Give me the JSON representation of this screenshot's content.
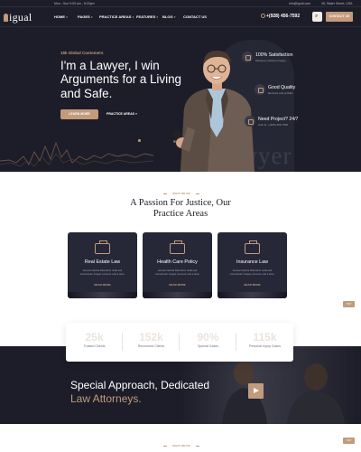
{
  "topbar": {
    "hours": "Mon - Sun 9:00 am - 8:00pm",
    "email": "info@igual.com",
    "address": "45, Water Street, USA"
  },
  "header": {
    "logo": "igual",
    "nav": [
      "HOME",
      "PAGES",
      "PRACTICE AREAS",
      "FEATURES",
      "BLOG",
      "CONTACT US"
    ],
    "phone": "+(928) 456-7592",
    "cta": "CONTACT US"
  },
  "hero": {
    "eyebrow": "15k Global Customers",
    "title": "I'm a Lawyer, I win Arguments for a Living and Safe.",
    "primary_button": "LEARN MORE",
    "secondary_link": "PRACTICE AREAS »",
    "watermark": "Lawyer",
    "features": [
      {
        "title": "100% Satisfaction",
        "subtitle": "Measure customer happy",
        "icon": "shield-icon"
      },
      {
        "title": "Good Quality",
        "subtitle": "Reviews and profiles",
        "icon": "thumbs-up-icon"
      },
      {
        "title": "Need Project? 24/7",
        "subtitle": "Call us: +(928) 456-7592",
        "icon": "phone-icon"
      }
    ]
  },
  "services": {
    "tag": "WHAT WE DO",
    "title_line1": "A Passion For Justice, Our",
    "title_line2": "Practice Areas",
    "cards": [
      {
        "title": "Real Estate Law",
        "description": "Aenean lacinia bibendum nulla sed consectetur integer posuere erat a ante.",
        "more": "READ MORE",
        "icon": "briefcase-icon"
      },
      {
        "title": "Health Care Policy",
        "description": "Aenean lacinia bibendum nulla sed consectetur integer posuere erat a ante.",
        "more": "READ MORE",
        "icon": "briefcase-icon"
      },
      {
        "title": "Insurance Law",
        "description": "Aenean lacinia bibendum nulla sed consectetur integer posuere erat a ante.",
        "more": "READ MORE",
        "icon": "briefcase-icon"
      }
    ]
  },
  "stats": [
    {
      "value": "25k",
      "label": "Trusted Clients"
    },
    {
      "value": "152k",
      "label": "Recovered Clients"
    },
    {
      "value": "90%",
      "label": "Special Cases"
    },
    {
      "value": "115k",
      "label": "Personal Injury Cases"
    }
  ],
  "special": {
    "line1": "Special Approach, Dedicated",
    "line2": "Law Attorneys."
  },
  "footer_tag": "WHAT WE DO",
  "scroll_chip": "TOP",
  "colors": {
    "accent": "#c29a7c",
    "dark": "#1c1d29",
    "card": "#262838"
  }
}
